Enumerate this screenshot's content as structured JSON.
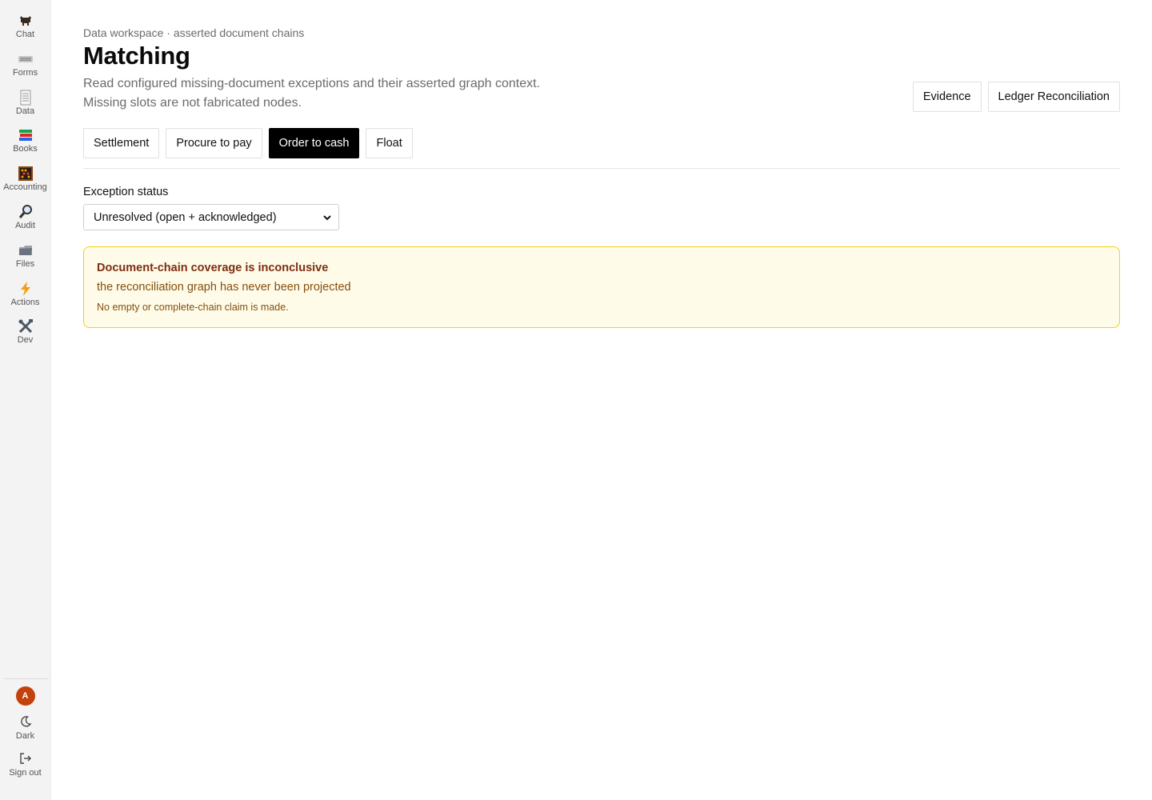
{
  "sidebar": {
    "items": [
      {
        "label": "Chat",
        "icon": "ox-icon"
      },
      {
        "label": "Forms",
        "icon": "keyboard-icon"
      },
      {
        "label": "Data",
        "icon": "spreadsheet-icon"
      },
      {
        "label": "Books",
        "icon": "books-icon"
      },
      {
        "label": "Accounting",
        "icon": "abacus-icon"
      },
      {
        "label": "Audit",
        "icon": "magnifier-icon"
      },
      {
        "label": "Files",
        "icon": "folder-icon"
      },
      {
        "label": "Actions",
        "icon": "lightning-icon"
      },
      {
        "label": "Dev",
        "icon": "tools-icon"
      }
    ],
    "avatar_initial": "A",
    "avatar_color": "#c2410c",
    "theme_label": "Dark",
    "signout_label": "Sign out"
  },
  "header": {
    "breadcrumb": "Data workspace · asserted document chains",
    "title": "Matching",
    "description_line1": "Read configured missing-document exceptions and their asserted graph context.",
    "description_line2": "Missing slots are not fabricated nodes."
  },
  "actions": {
    "evidence_label": "Evidence",
    "ledger_label": "Ledger Reconciliation"
  },
  "tabs": [
    {
      "label": "Settlement",
      "active": false
    },
    {
      "label": "Procure to pay",
      "active": false
    },
    {
      "label": "Order to cash",
      "active": true
    },
    {
      "label": "Float",
      "active": false
    }
  ],
  "filter": {
    "label": "Exception status",
    "selected": "Unresolved (open + acknowledged)"
  },
  "alert": {
    "title": "Document-chain coverage is inconclusive",
    "body": "the reconciliation graph has never been projected",
    "note": "No empty or complete-chain claim is made.",
    "bg_color": "#fefce8",
    "border_color": "#facc15"
  }
}
